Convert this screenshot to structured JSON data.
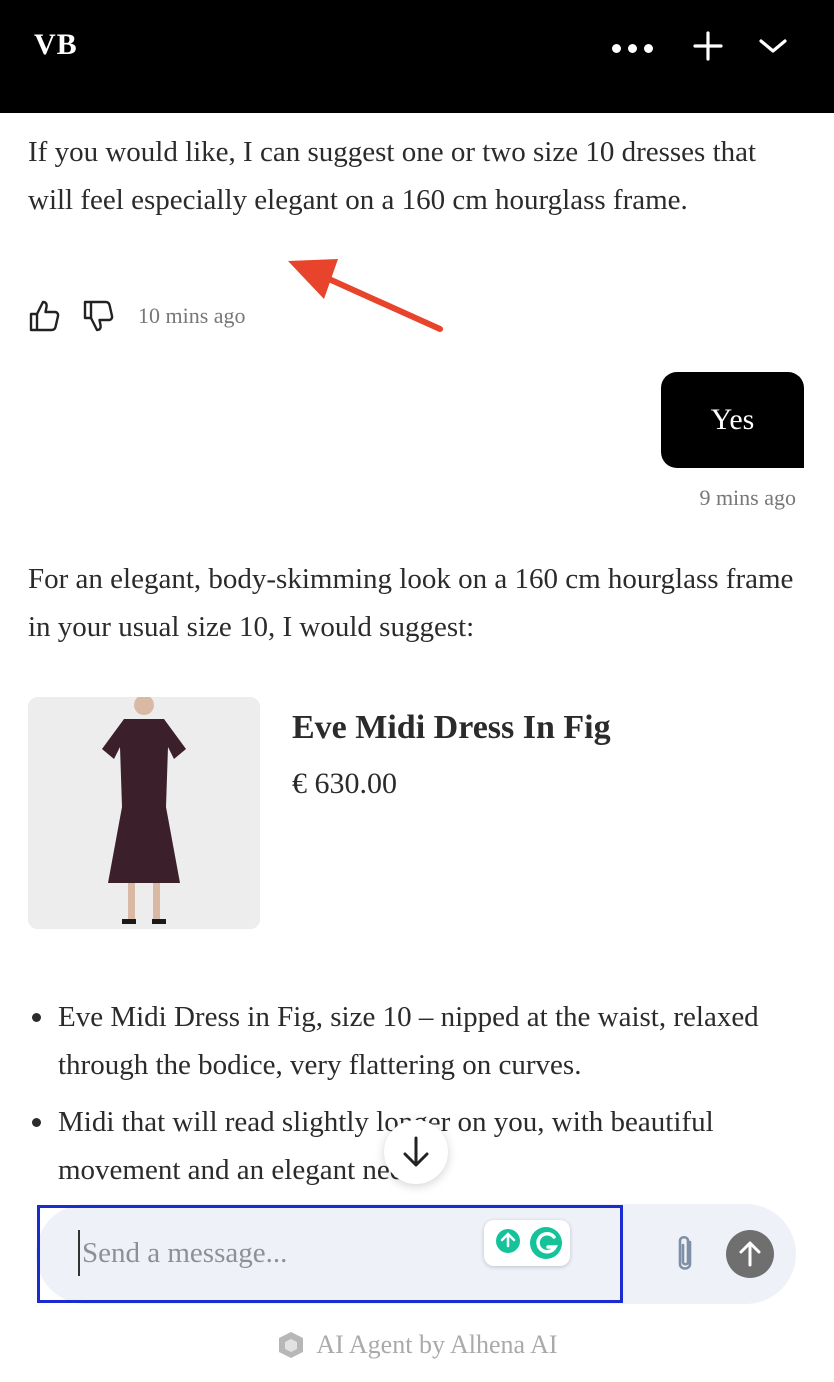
{
  "header": {
    "brand": "VB",
    "icons": [
      "more-dots-icon",
      "plus-icon",
      "chevron-down-icon"
    ]
  },
  "messages": {
    "bot_1": "If you would like, I can suggest one or two size 10 dresses that will feel especially elegant on a 160 cm hourglass frame.",
    "bot_1_time": "10 mins ago",
    "user_1": "Yes",
    "user_1_time": "9 mins ago",
    "bot_2": "For an elegant, body-skimming look on a 160 cm hourglass frame in your usual size 10, I would suggest:"
  },
  "product": {
    "name": "Eve Midi Dress In Fig",
    "price": "€ 630.00"
  },
  "bullets": [
    "Eve Midi Dress in Fig, size 10 – nipped at the waist, relaxed through the bodice, very flattering on curves.",
    "Midi that will read slightly longer on you, with beautiful movement and an elegant neck."
  ],
  "composer": {
    "placeholder": "Send a message..."
  },
  "footer": {
    "text": "AI Agent by Alhena AI"
  },
  "colors": {
    "header_bg": "#000000",
    "user_bubble": "#000000",
    "annotation_arrow": "#e8432b",
    "focus_outline": "#1a2ccf",
    "composer_bg": "#eef2f8"
  }
}
